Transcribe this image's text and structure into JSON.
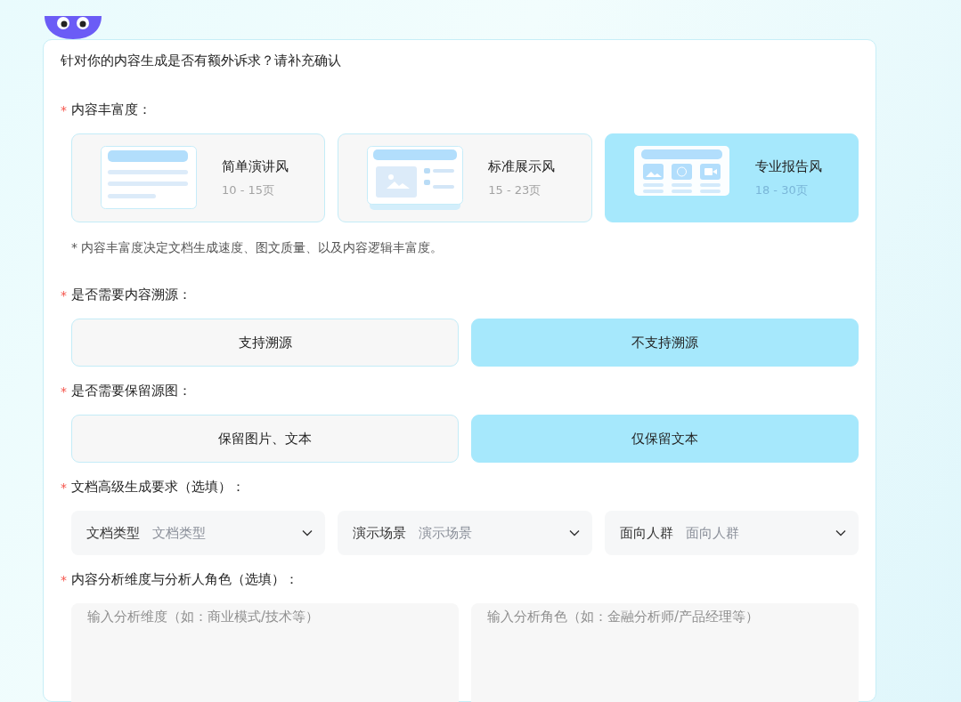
{
  "prompt": "针对你的内容生成是否有额外诉求？请补充确认",
  "richness": {
    "required_mark": "*",
    "label": "内容丰富度：",
    "options": [
      {
        "kind": "simple",
        "title": "简单演讲风",
        "pages": "10 - 15页",
        "selected": false
      },
      {
        "kind": "standard",
        "title": "标准展示风",
        "pages": "15 - 23页",
        "selected": false
      },
      {
        "kind": "professional",
        "title": "专业报告风",
        "pages": "18 - 30页",
        "selected": true
      }
    ],
    "note": "* 内容丰富度决定文档生成速度、图文质量、以及内容逻辑丰富度。"
  },
  "traceable": {
    "required_mark": "*",
    "label": "是否需要内容溯源：",
    "options": [
      {
        "label": "支持溯源",
        "selected": false
      },
      {
        "label": "不支持溯源",
        "selected": true
      }
    ]
  },
  "keep_images": {
    "required_mark": "*",
    "label": "是否需要保留源图：",
    "options": [
      {
        "label": "保留图片、文本",
        "selected": false
      },
      {
        "label": "仅保留文本",
        "selected": true
      }
    ]
  },
  "advanced": {
    "required_mark": "*",
    "label": "文档高级生成要求（选填）：",
    "selects": [
      {
        "label": "文档类型",
        "placeholder": "文档类型"
      },
      {
        "label": "演示场景",
        "placeholder": "演示场景"
      },
      {
        "label": "面向人群",
        "placeholder": "面向人群"
      }
    ]
  },
  "analysis": {
    "required_mark": "*",
    "label": "内容分析维度与分析人角色（选填）：",
    "fields": [
      {
        "placeholder": "输入分析维度（如：商业模式/技术等）"
      },
      {
        "placeholder": "输入分析角色（如：金融分析师/产品经理等）"
      }
    ]
  }
}
